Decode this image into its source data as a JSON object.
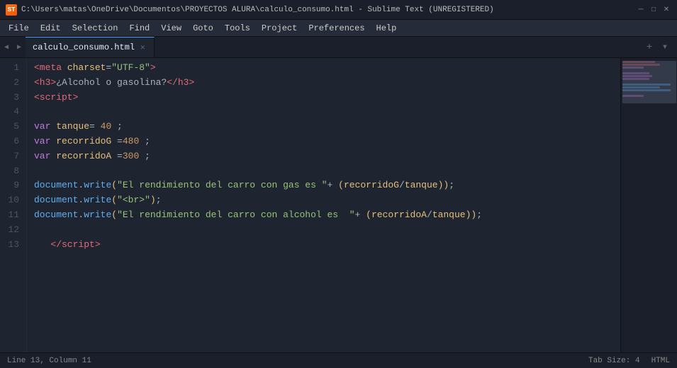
{
  "titlebar": {
    "path": "C:\\Users\\matas\\OneDrive\\Documentos\\PROYECTOS ALURA\\calculo_consumo.html - Sublime Text (UNREGISTERED)",
    "app_icon": "ST"
  },
  "menu": {
    "items": [
      "File",
      "Edit",
      "Selection",
      "Find",
      "View",
      "Goto",
      "Tools",
      "Project",
      "Preferences",
      "Help"
    ]
  },
  "tabs": {
    "active_tab": "calculo_consumo.html",
    "new_tab_label": "+",
    "chevron_label": "▾"
  },
  "editor": {
    "lines": [
      {
        "num": "1",
        "content": ""
      },
      {
        "num": "2",
        "content": ""
      },
      {
        "num": "3",
        "content": ""
      },
      {
        "num": "4",
        "content": ""
      },
      {
        "num": "5",
        "content": ""
      },
      {
        "num": "6",
        "content": ""
      },
      {
        "num": "7",
        "content": ""
      },
      {
        "num": "8",
        "content": ""
      },
      {
        "num": "9",
        "content": ""
      },
      {
        "num": "10",
        "content": ""
      },
      {
        "num": "11",
        "content": ""
      },
      {
        "num": "12",
        "content": ""
      },
      {
        "num": "13",
        "content": ""
      }
    ]
  },
  "statusbar": {
    "position": "Line 13, Column 11",
    "tab_size": "Tab Size: 4",
    "language": "HTML"
  },
  "minimap": {
    "colors": [
      "#e06c75",
      "#c678dd",
      "#c678dd",
      "transparent",
      "#c678dd",
      "#c678dd",
      "#c678dd",
      "transparent",
      "#61afef",
      "#61afef",
      "#61afef",
      "transparent",
      "#c678dd"
    ]
  }
}
